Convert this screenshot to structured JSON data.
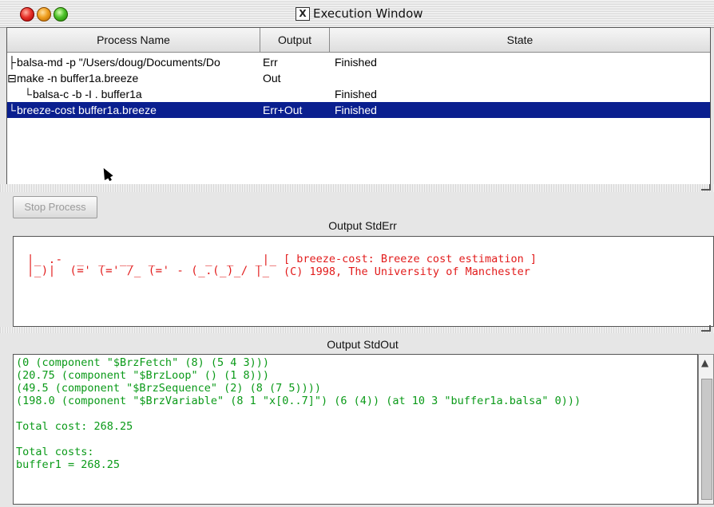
{
  "window": {
    "title": "Execution Window",
    "icon_glyph": "X",
    "controls": [
      "close",
      "minimize",
      "zoom"
    ]
  },
  "process_table": {
    "columns": [
      "Process Name",
      "Output",
      "State"
    ],
    "rows": [
      {
        "tree": "├",
        "name": "balsa-md -p \"/Users/doug/Documents/Do",
        "output": "Err",
        "state": "Finished",
        "selected": false
      },
      {
        "tree": "⊟",
        "name": "make -n buffer1a.breeze",
        "output": "Out",
        "state": "",
        "selected": false
      },
      {
        "tree": "└",
        "name": "balsa-c -b -I .  buffer1a",
        "output": "",
        "state": "Finished",
        "selected": false
      },
      {
        "tree": "└",
        "name": "breeze-cost buffer1a.breeze",
        "output": "Err+Out",
        "state": "Finished",
        "selected": true
      }
    ]
  },
  "stop_button": {
    "label": "Stop Process",
    "enabled": false
  },
  "stderr": {
    "title": "Output StdErr",
    "ascii_art": [
      " |_ .-  _  _  __  _       _  _   _|_",
      " |_)|  (=' (=' /_ (=' - (_.(_)_/ |_ "
    ],
    "lines": [
      "[ breeze-cost: Breeze cost estimation ]",
      "(C) 1998, The University of Manchester"
    ]
  },
  "stdout": {
    "title": "Output StdOut",
    "lines": [
      "(0 (component \"$BrzFetch\" (8) (5 4 3)))",
      "(20.75 (component \"$BrzLoop\" () (1 8)))",
      "(49.5 (component \"$BrzSequence\" (2) (8 (7 5))))",
      "(198.0 (component \"$BrzVariable\" (8 1 \"x[0..7]\") (6 (4)) (at 10 3 \"buffer1a.balsa\" 0)))",
      "",
      "Total cost: 268.25",
      "",
      "Total costs:",
      "buffer1 = 268.25"
    ]
  },
  "colors": {
    "selection": "#0a1f8f",
    "stderr_text": "#e21b1b",
    "stdout_text": "#0a9a18"
  }
}
